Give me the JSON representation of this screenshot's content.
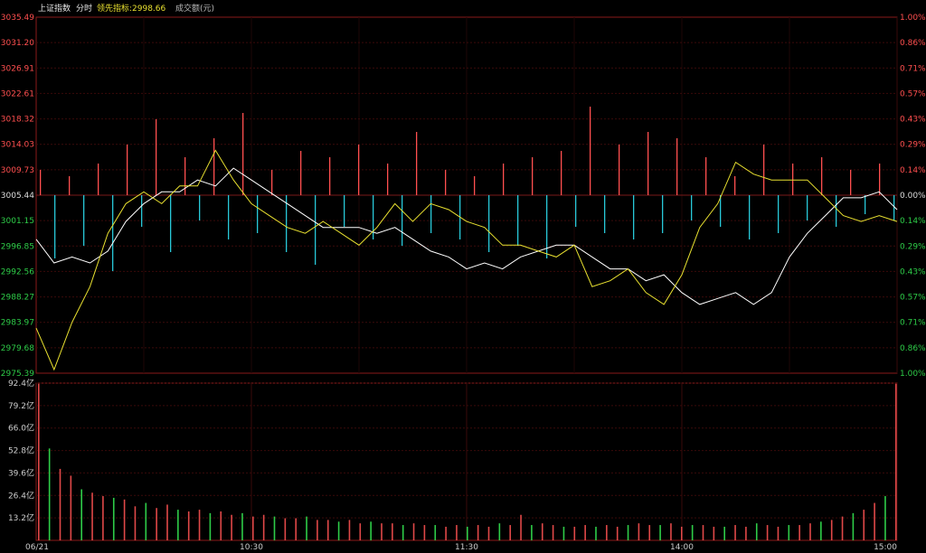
{
  "header": {
    "index_name": "上证指数",
    "mode": "分时",
    "leading_indicator": "领先指标:2998.66",
    "volume_label": "成交额(元)"
  },
  "colors": {
    "up": "#ff4f4f",
    "down": "#28c8d8",
    "flat": "#dddddd",
    "vol_up": "#e04848",
    "vol_down": "#2ecc48",
    "price_line": "#ffffff",
    "lead_line": "#e8e030",
    "grid": "#3a0a0a",
    "frame": "#8a1a1a"
  },
  "chart_data": {
    "type": "line",
    "prev_close": 3005.44,
    "price_axis": {
      "ylim": [
        2975.39,
        3035.49
      ],
      "ticks": [
        "3035.49",
        "3031.20",
        "3026.91",
        "3022.61",
        "3018.32",
        "3014.03",
        "3009.73",
        "3005.44",
        "3001.15",
        "2996.85",
        "2992.56",
        "2988.27",
        "2983.97",
        "2979.68",
        "2975.39"
      ]
    },
    "pct_axis": {
      "ticks": [
        "1.00%",
        "0.86%",
        "0.71%",
        "0.57%",
        "0.43%",
        "0.29%",
        "0.14%",
        "0.00%",
        "0.14%",
        "0.29%",
        "0.43%",
        "0.57%",
        "0.71%",
        "0.86%",
        "1.00%"
      ]
    },
    "volume_axis": {
      "ylim": [
        0,
        92.4
      ],
      "ticks": [
        "92.4亿",
        "79.2亿",
        "66.0亿",
        "52.8亿",
        "39.6亿",
        "26.4亿",
        "13.2亿"
      ]
    },
    "x_labels": [
      "06/21",
      "10:30",
      "11:30",
      "14:00",
      "15:00"
    ],
    "x": [
      0,
      5,
      10,
      15,
      20,
      25,
      30,
      35,
      40,
      45,
      50,
      55,
      60,
      65,
      70,
      75,
      80,
      85,
      90,
      95,
      100,
      105,
      110,
      115,
      120,
      125,
      130,
      135,
      140,
      145,
      150,
      155,
      160,
      165,
      170,
      175,
      180,
      185,
      190,
      195,
      200,
      205,
      210,
      215,
      220,
      225,
      230,
      235,
      240
    ],
    "series": [
      {
        "values": [
          2998,
          2994,
          2995,
          2994,
          2996,
          3001,
          3004,
          3006,
          3006,
          3008,
          3007,
          3010,
          3008,
          3006,
          3004,
          3002,
          3000,
          3000,
          3000,
          2999,
          3000,
          2998,
          2996,
          2995,
          2993,
          2994,
          2993,
          2995,
          2996,
          2997,
          2997,
          2995,
          2993,
          2993,
          2991,
          2992,
          2989,
          2987,
          2988,
          2989,
          2987,
          2989,
          2995,
          2999,
          3002,
          3005,
          3005,
          3006,
          3003
        ]
      },
      {
        "values": [
          2983,
          2976,
          2984,
          2990,
          2999,
          3004,
          3006,
          3004,
          3007,
          3007,
          3013,
          3008,
          3004,
          3002,
          3000,
          2999,
          3001,
          2999,
          2997,
          3000,
          3004,
          3001,
          3004,
          3003,
          3001,
          3000,
          2997,
          2997,
          2996,
          2995,
          2997,
          2990,
          2991,
          2993,
          2989,
          2987,
          2992,
          3000,
          3004,
          3011,
          3009,
          3008,
          3008,
          3008,
          3005,
          3002,
          3001,
          3002,
          3001
        ]
      }
    ],
    "activity": [
      0.4,
      -1.0,
      0.3,
      -0.8,
      0.5,
      -1.2,
      0.8,
      -0.5,
      1.2,
      -0.9,
      0.6,
      -0.4,
      0.9,
      -0.7,
      1.3,
      -0.6,
      0.4,
      -0.9,
      0.7,
      -1.1,
      0.6,
      -0.5,
      0.8,
      -0.7,
      0.5,
      -0.8,
      1.0,
      -0.6,
      0.4,
      -0.7,
      0.3,
      -0.9,
      0.5,
      -0.8,
      0.6,
      -1.0,
      0.7,
      -0.5,
      1.4,
      -0.6,
      0.8,
      -0.7,
      1.0,
      -0.6,
      0.9,
      -0.4,
      0.6,
      -0.5,
      0.3,
      -0.7,
      0.8,
      -0.6,
      0.5,
      -0.4,
      0.6,
      -0.5,
      0.4,
      -0.3,
      0.5,
      -0.4
    ],
    "volume": [
      92,
      54,
      42,
      38,
      30,
      28,
      26,
      25,
      24,
      20,
      22,
      19,
      21,
      18,
      17,
      18,
      16,
      17,
      15,
      16,
      14,
      15,
      14,
      13,
      13,
      14,
      12,
      12,
      11,
      12,
      10,
      11,
      10,
      10,
      9,
      10,
      9,
      9,
      8,
      9,
      8,
      9,
      8,
      10,
      9,
      15,
      9,
      10,
      9,
      8,
      8,
      9,
      8,
      9,
      8,
      9,
      10,
      9,
      9,
      10,
      8,
      9,
      9,
      8,
      8,
      9,
      8,
      10,
      9,
      8,
      9,
      9,
      10,
      11,
      12,
      14,
      16,
      18,
      22,
      26,
      92
    ]
  }
}
